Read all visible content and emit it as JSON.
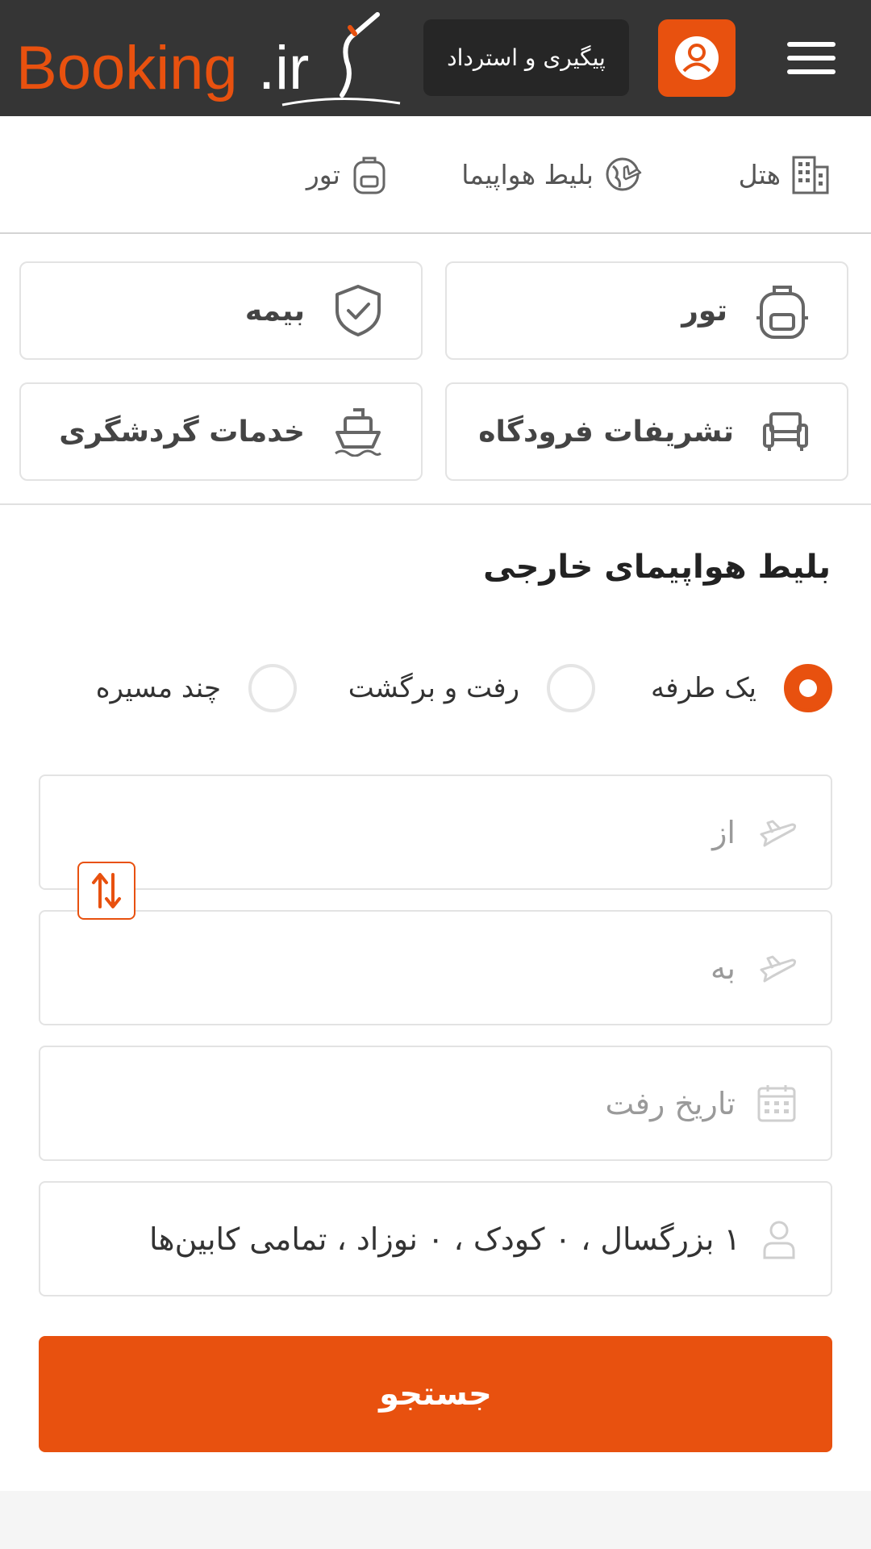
{
  "header": {
    "logo_text": "Booking",
    "logo_suffix": ".ir",
    "track_label": "پیگیری و استرداد",
    "user_icon": "user-icon",
    "menu_icon": "hamburger-icon",
    "accent_color": "#e8510f",
    "bg_color": "#353535"
  },
  "quick_nav": [
    {
      "label": "هتل",
      "icon": "building-icon"
    },
    {
      "label": "بلیط هواپیما",
      "icon": "globe-plane-icon"
    },
    {
      "label": "تور",
      "icon": "backpack-icon"
    }
  ],
  "services": [
    {
      "label": "تور",
      "icon": "backpack-icon"
    },
    {
      "label": "بیمه",
      "icon": "shield-check-icon"
    },
    {
      "label": "تشریفات فرودگاه",
      "icon": "armchair-icon"
    },
    {
      "label": "خدمات گردشگری",
      "icon": "ship-icon"
    }
  ],
  "search": {
    "title": "بلیط هواپیمای خارجی",
    "trip_types": [
      {
        "label": "یک طرفه",
        "selected": true
      },
      {
        "label": "رفت و برگشت",
        "selected": false
      },
      {
        "label": "چند مسیره",
        "selected": false
      }
    ],
    "from_placeholder": "از",
    "to_placeholder": "به",
    "date_placeholder": "تاریخ رفت",
    "passengers_value": "۱ بزرگسال ، ۰ کودک ، ۰ نوزاد ، تمامی کابین‌ها",
    "submit_label": "جستجو"
  }
}
